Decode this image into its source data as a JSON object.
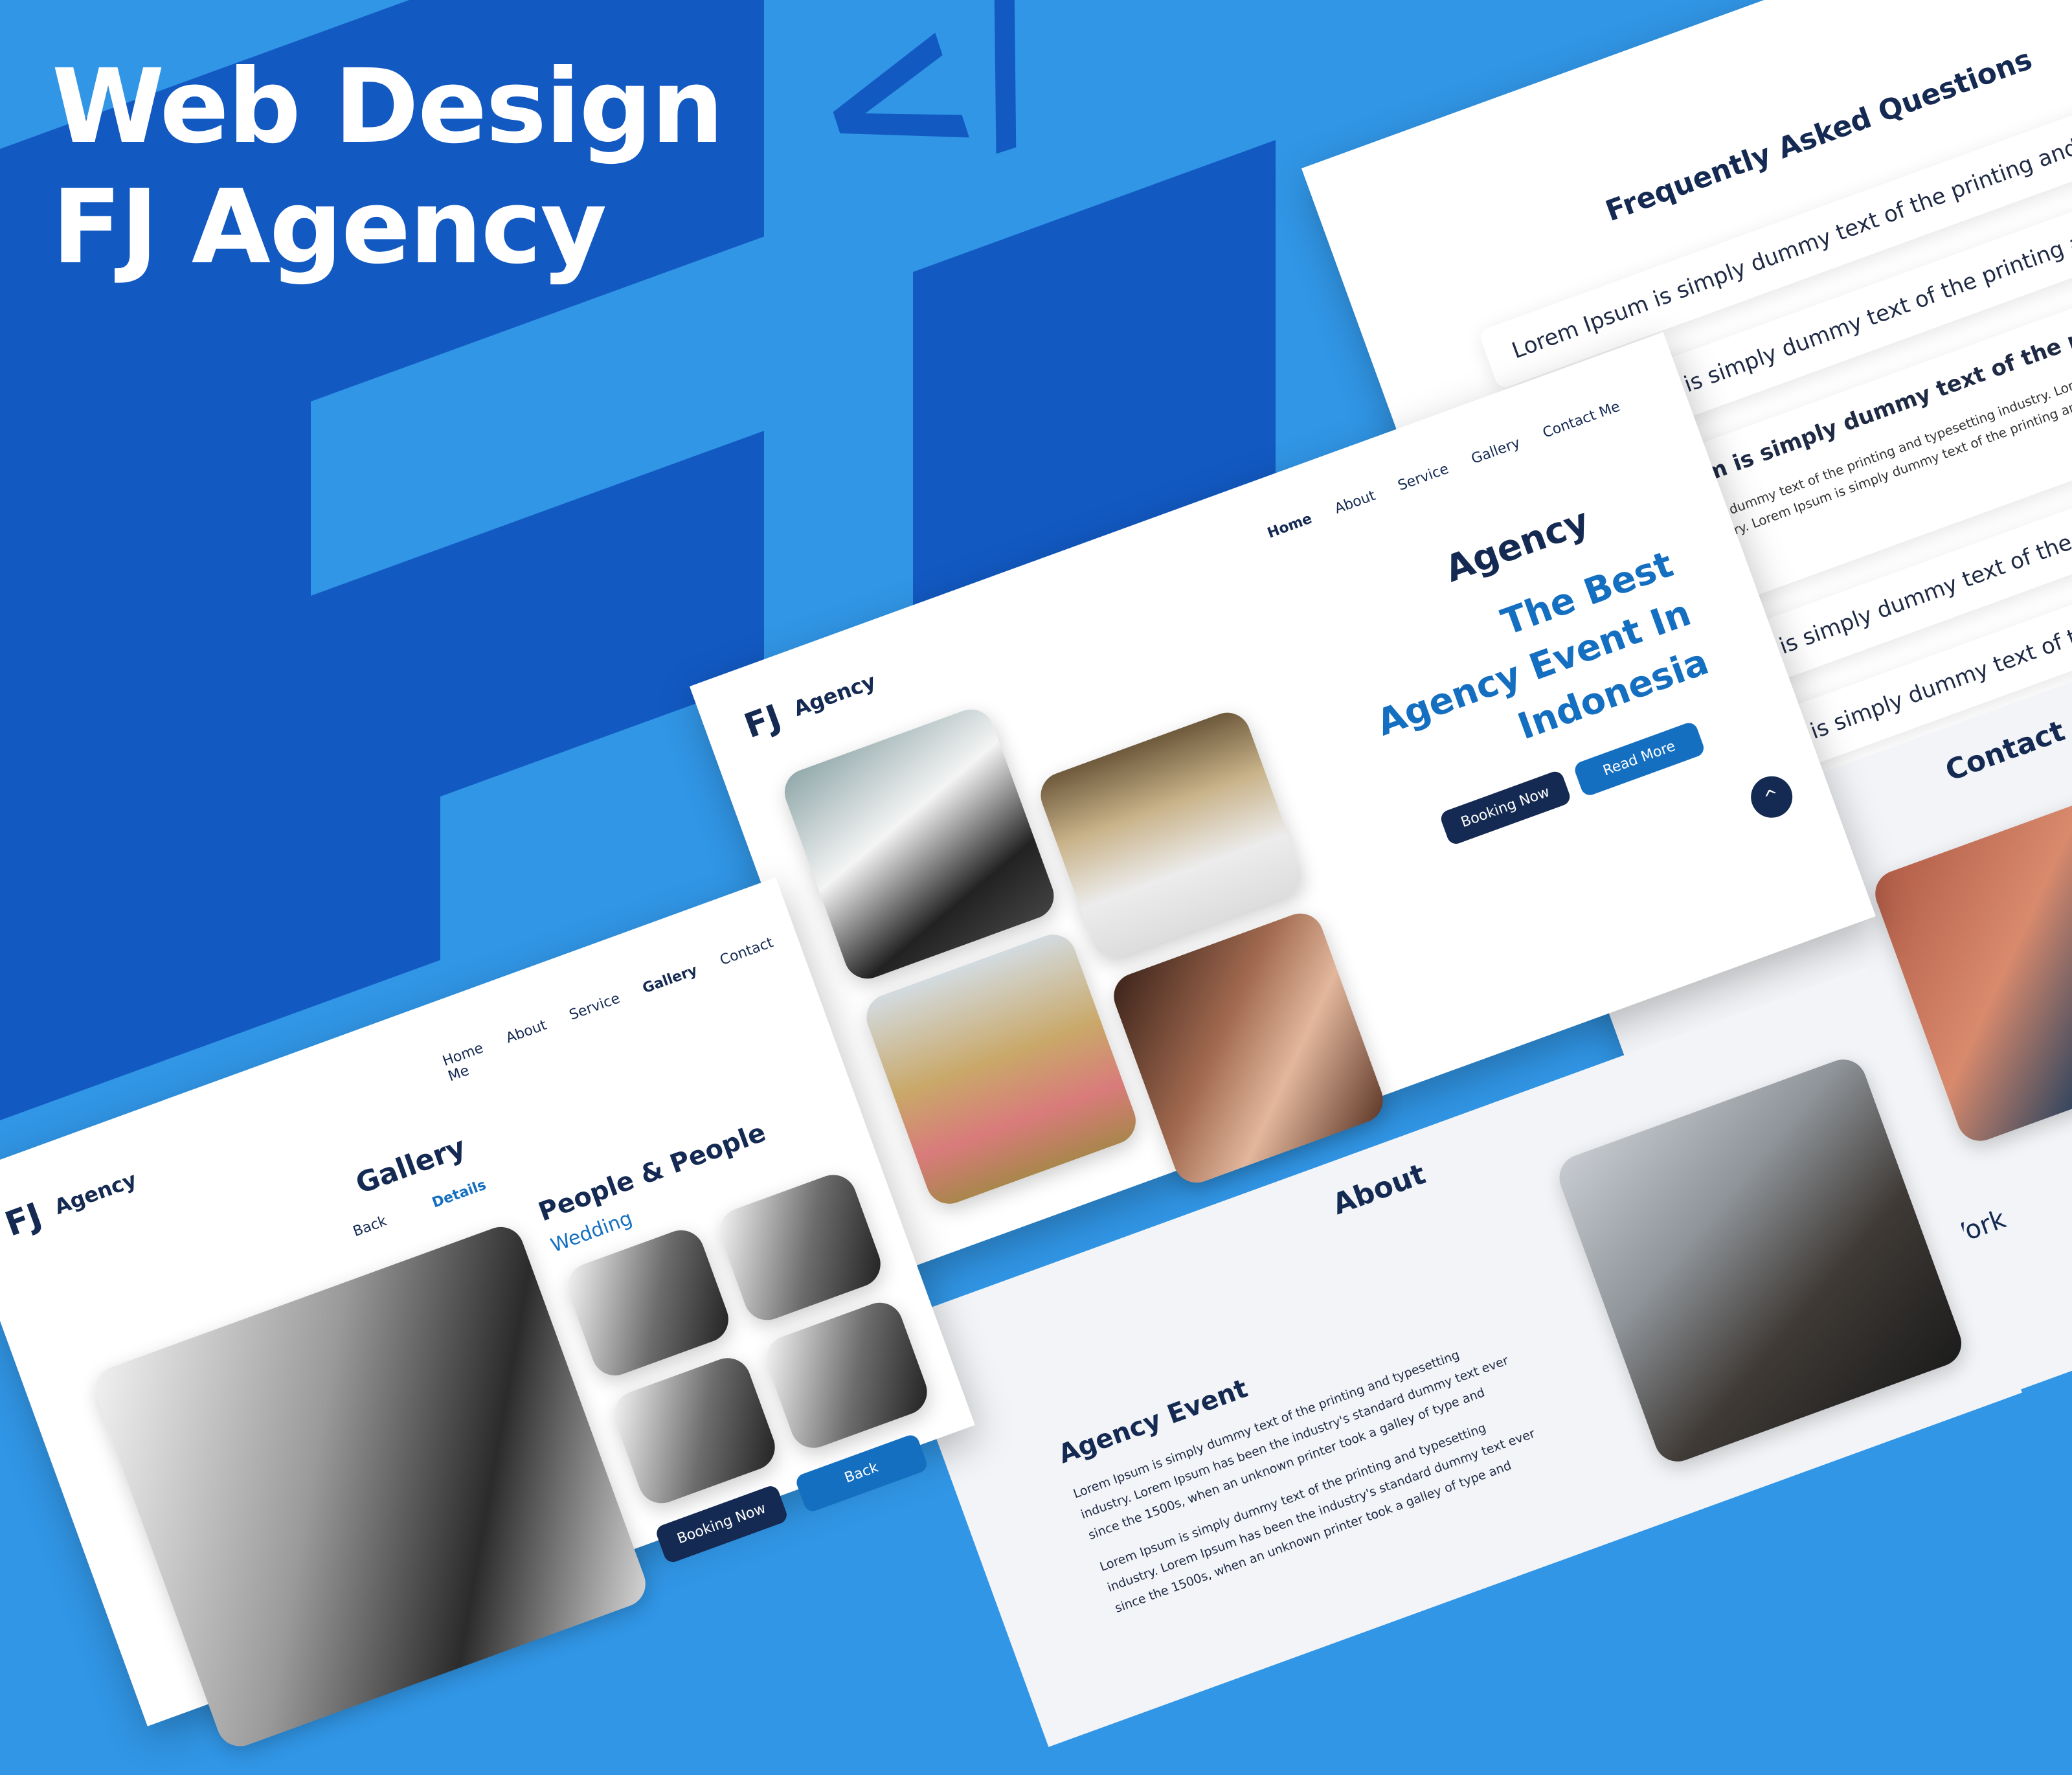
{
  "hero": {
    "line1": "Web Design",
    "line2": "FJ Agency",
    "code_glyph": "</"
  },
  "faq": {
    "title": "Frequently Asked Questions",
    "items": [
      "Lorem Ipsum is simply dummy text of the printing and typesetting ind",
      "Lorem Ipsum is simply dummy text of the printing and typesetting",
      "Lorem Ipsum is simply dummy text of the printing and typese",
      "Lorem Ipsum is simply dummy text of the printing and typ",
      "Lorem Ipsum is simply dummy text of the printing and"
    ],
    "expanded_body": "Lorem Ipsum is simply dummy text of the printing and typesetting industry. Lorem Ipsum is simply dummy text of the printing and typesetting industry. Lorem Ipsum is simply dummy text of the printing and typesetting industry"
  },
  "home": {
    "logo": "FJ",
    "brand": "Agency",
    "nav": [
      "Home",
      "About",
      "Service",
      "Gallery",
      "Contact Me"
    ],
    "heading": "Agency",
    "tagline_1": "The Best",
    "tagline_2": "Agency Event In",
    "tagline_3": "Indonesia",
    "booking": "Booking Now",
    "read_more": "Read More"
  },
  "about": {
    "title": "About",
    "subtitle": "Agency Event",
    "para1": "Lorem Ipsum is simply dummy text of the printing and typesetting industry. Lorem Ipsum has been the industry's standard dummy text ever since the 1500s, when an unknown printer took a galley of type and",
    "para2": "Lorem Ipsum is simply dummy text of the printing and typesetting industry. Lorem Ipsum has been the industry's standard dummy text ever since the 1500s, when an unknown printer took a galley of type and"
  },
  "contact": {
    "title": "Contact",
    "line1": "t",
    "line2": "Vork"
  },
  "gallery": {
    "logo": "FJ",
    "brand": "Agency",
    "nav": [
      "Home",
      "About",
      "Service",
      "Gallery",
      "Contact Me"
    ],
    "title": "Gallery",
    "back": "Back",
    "details": "Details",
    "section": "People & People",
    "category": "Wedding",
    "booking": "Booking Now",
    "back_btn": "Back"
  },
  "colors": {
    "background": "#3196e6",
    "dark_block": "#1259c2",
    "navy": "#152a52",
    "accent_blue": "#156fc0"
  }
}
